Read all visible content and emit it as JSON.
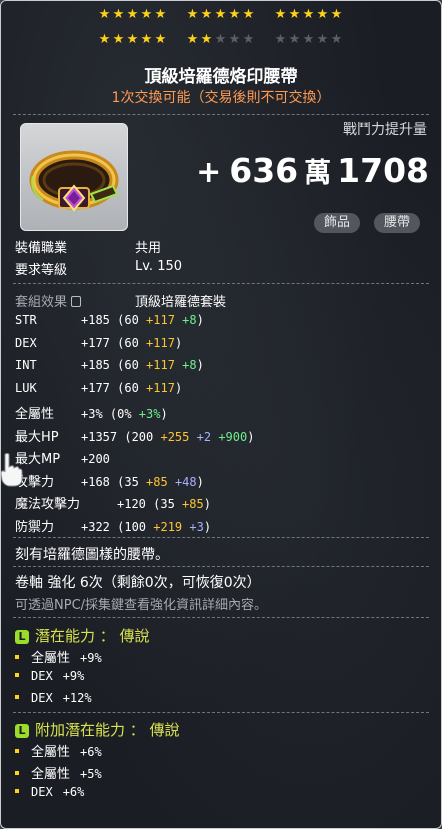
{
  "stars": {
    "row1": [
      {
        "on": [
          1,
          1,
          1,
          1,
          1
        ]
      },
      {
        "on": [
          1,
          1,
          1,
          1,
          1
        ]
      },
      {
        "on": [
          1,
          1,
          1,
          1,
          1
        ]
      }
    ],
    "row2": [
      {
        "on": [
          1,
          1,
          1,
          1,
          1
        ]
      },
      {
        "on": [
          1,
          1,
          0,
          0,
          0
        ]
      },
      {
        "on": [
          0,
          0,
          0,
          0,
          0
        ]
      }
    ],
    "star_glyph": "★"
  },
  "item": {
    "name": "頂級培羅德烙印腰帶",
    "trade_note": "1次交換可能（交易後則不可交換）",
    "power_label": "戰鬥力提升量",
    "power_plus": "+",
    "power_num1": "636",
    "power_unit": "萬",
    "power_num2": "1708",
    "tag1": "飾品",
    "tag2": "腰帶"
  },
  "info": {
    "job_label": "裝備職業",
    "job_value": "共用",
    "level_label": "要求等級",
    "level_value": "Lv. 150"
  },
  "set": {
    "label": "套組效果",
    "value": "頂級培羅德套裝"
  },
  "stats": [
    {
      "name": "STR",
      "parts": [
        "+185 (60 ",
        "+117",
        " ",
        "+8",
        ")"
      ],
      "colors": [
        "",
        "y",
        "",
        "g",
        ""
      ]
    },
    {
      "name": "DEX",
      "parts": [
        "+177 (60 ",
        "+117",
        ")"
      ],
      "colors": [
        "",
        "y",
        ""
      ]
    },
    {
      "name": "INT",
      "parts": [
        "+185 (60 ",
        "+117",
        " ",
        "+8",
        ")"
      ],
      "colors": [
        "",
        "y",
        "",
        "g",
        ""
      ]
    },
    {
      "name": "LUK",
      "parts": [
        "+177 (60 ",
        "+117",
        ")"
      ],
      "colors": [
        "",
        "y",
        ""
      ]
    }
  ],
  "stats2": [
    {
      "name": "全屬性",
      "parts": [
        "+3% (0% ",
        "+3%",
        ")"
      ],
      "colors": [
        "",
        "g",
        ""
      ]
    },
    {
      "name": "最大HP",
      "parts": [
        "+1357 (200 ",
        "+255",
        " ",
        "+2",
        " ",
        "+900",
        ")"
      ],
      "colors": [
        "",
        "y",
        "",
        "b",
        "",
        "g",
        ""
      ]
    },
    {
      "name": "最大MP",
      "parts": [
        "+200"
      ],
      "colors": [
        ""
      ]
    },
    {
      "name": "攻擊力",
      "parts": [
        "+168 (35 ",
        "+85",
        " ",
        "+48",
        ")"
      ],
      "colors": [
        "",
        "y",
        "",
        "b",
        ""
      ]
    },
    {
      "name": "魔法攻擊力",
      "parts": [
        "+120 (35 ",
        "+85",
        ")"
      ],
      "colors": [
        "",
        "y",
        ""
      ]
    },
    {
      "name": "防禦力",
      "parts": [
        "+322 (100 ",
        "+219",
        " ",
        "+3",
        ")"
      ],
      "colors": [
        "",
        "y",
        "",
        "b",
        ""
      ]
    }
  ],
  "description": "刻有培羅德圖樣的腰帶。",
  "scroll": {
    "text": "卷軸 強化 6次（剩餘0次，可恢復0次）",
    "hint": "可透過NPC/採集鍵查看強化資訊詳細內容。"
  },
  "potential": {
    "badge": "L",
    "title": "潛在能力 ： 傳說",
    "lines": [
      {
        "name": "全屬性",
        "value": "+9%",
        "color": "#ffd21a"
      },
      {
        "name": "DEX",
        "value": "+9%",
        "color": "#ffd21a"
      },
      {
        "name": "DEX",
        "value": "+12%",
        "color": "#ffd21a"
      }
    ]
  },
  "additional": {
    "badge": "L",
    "title": "附加潛在能力 ： 傳說",
    "lines": [
      {
        "name": "全屬性",
        "value": "+6%",
        "color": "#ffd21a"
      },
      {
        "name": "全屬性",
        "value": "+5%",
        "color": "#ffd21a"
      },
      {
        "name": "DEX",
        "value": "+6%",
        "color": "#ffd21a"
      }
    ]
  }
}
